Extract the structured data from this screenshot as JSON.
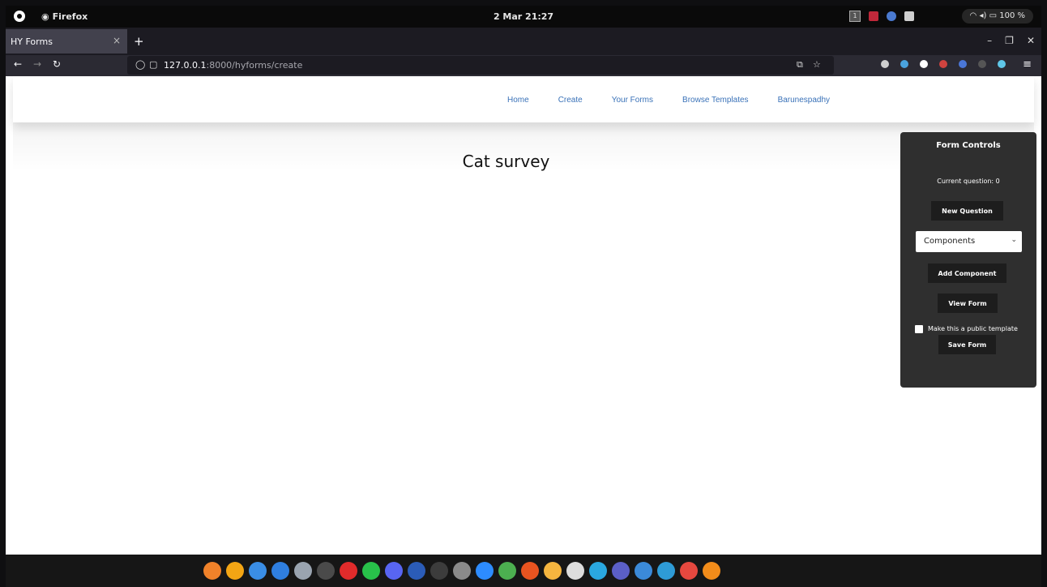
{
  "system": {
    "app_name": "Firefox",
    "clock": "2 Mar  21:27",
    "workspace": "1",
    "status": "100 %"
  },
  "browser": {
    "tab_title": "HY Forms",
    "tab_close": "×",
    "new_tab": "+",
    "url_host": "127.0.0.1",
    "url_rest": ":8000/hyforms/create"
  },
  "site_nav": {
    "items": [
      "Home",
      "Create",
      "Your Forms",
      "Browse Templates",
      "Barunespadhy"
    ]
  },
  "form": {
    "title": "Cat survey"
  },
  "controls": {
    "heading": "Form Controls",
    "current_question": "Current question: 0",
    "new_question": "New Question",
    "components_select": "Components",
    "add_component": "Add Component",
    "view_form": "View Form",
    "public_template": "Make this a public template",
    "save_form": "Save Form"
  },
  "colors": {
    "link": "#3a72b8",
    "panel": "#2f2f2f",
    "button": "#1d1d1d"
  },
  "dock_icons": [
    "firefox-icon",
    "sublime-icon",
    "chrome-icon",
    "mail-icon",
    "settings-icon",
    "terminal-icon",
    "media-player-icon",
    "whatsapp-icon",
    "discord-icon",
    "word-icon",
    "steam-icon",
    "settings-wheel-icon",
    "zoom-icon",
    "remote-desktop-icon",
    "ubuntu-icon",
    "files-icon",
    "kite-icon",
    "virtualbox-icon",
    "teams-icon",
    "vscode-icon",
    "browser-icon",
    "pdf-icon",
    "text-editor-icon"
  ]
}
